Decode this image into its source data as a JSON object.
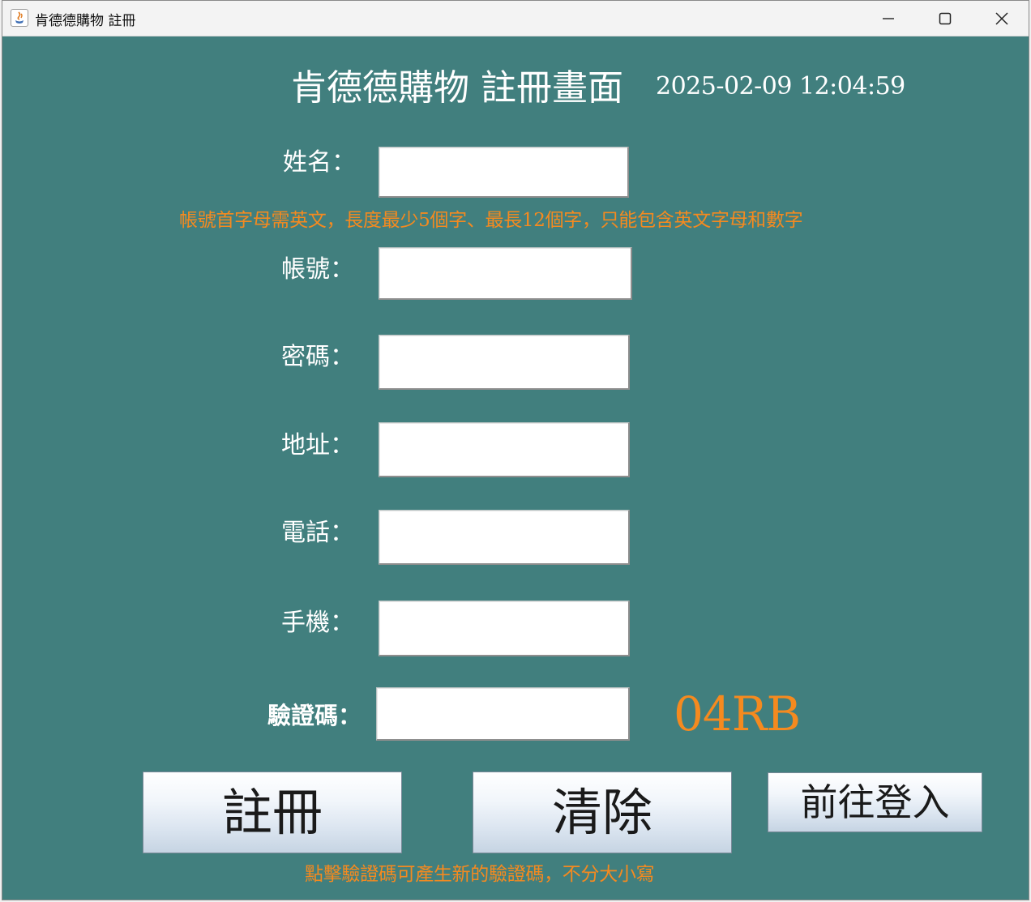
{
  "window": {
    "title": "肯德德購物 註冊",
    "controls": {
      "minimize": "minimize",
      "maximize": "maximize",
      "close": "close"
    }
  },
  "header": {
    "title": "肯德德購物 註冊畫面",
    "datetime": "2025-02-09 12:04:59"
  },
  "form": {
    "name_label": "姓名：",
    "account_hint": "帳號首字母需英文，長度最少5個字、最長12個字，只能包含英文字母和數字",
    "account_label": "帳號：",
    "password_label": "密碼：",
    "address_label": "地址：",
    "phone_label": "電話：",
    "mobile_label": "手機：",
    "captcha_label": "驗證碼：",
    "captcha_code": "04RB",
    "values": {
      "name": "",
      "account": "",
      "password": "",
      "address": "",
      "phone": "",
      "mobile": "",
      "captcha": ""
    }
  },
  "buttons": {
    "register": "註冊",
    "clear": "清除",
    "go_login": "前往登入"
  },
  "footer": {
    "captcha_hint": "點擊驗證碼可產生新的驗證碼，不分大小寫"
  },
  "colors": {
    "background": "#417f7e",
    "hint": "#f58a1f",
    "label": "#ffffff"
  }
}
